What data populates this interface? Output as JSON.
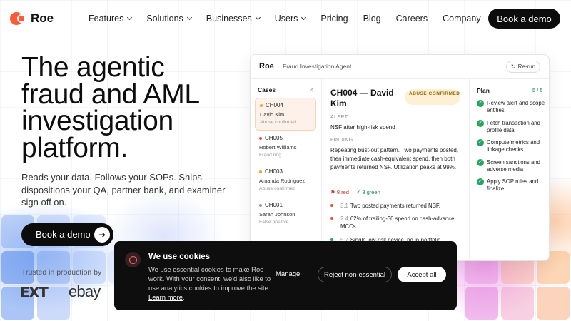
{
  "nav": {
    "brand": "Roe",
    "links": [
      {
        "label": "Features",
        "dropdown": true
      },
      {
        "label": "Solutions",
        "dropdown": true
      },
      {
        "label": "Businesses",
        "dropdown": true
      },
      {
        "label": "Users",
        "dropdown": true
      },
      {
        "label": "Pricing",
        "dropdown": false
      },
      {
        "label": "Blog",
        "dropdown": false
      },
      {
        "label": "Careers",
        "dropdown": false
      },
      {
        "label": "Company",
        "dropdown": false
      }
    ],
    "cta": "Book a demo"
  },
  "hero": {
    "title_lines": [
      "The agentic",
      "fraud and AML",
      "investigation",
      "platform."
    ],
    "subtitle": "Reads your data. Follows your SOPs. Ships dispositions your QA, partner bank, and examiner sign off on.",
    "cta": "Book a demo",
    "cta_icon": "arrow-right-icon",
    "trusted_label": "Trusted in production by",
    "customer_logos": [
      "EXT",
      "ebay"
    ]
  },
  "app": {
    "brand": "Roe",
    "agent_name": "Fraud Investigation Agent",
    "rerun_label": "Re-run",
    "cases": {
      "title": "Cases",
      "count": "4",
      "items": [
        {
          "id": "CH004",
          "name": "David Kim",
          "status": "Abuse confirmed",
          "dot_color": "#f0a030",
          "active": true
        },
        {
          "id": "CH005",
          "name": "Robert Williams",
          "status": "Fraud ring",
          "dot_color": "#e05a3a",
          "active": false
        },
        {
          "id": "CH003",
          "name": "Amanda Rodriguez",
          "status": "Abuse confirmed",
          "dot_color": "#f0a030",
          "active": false
        },
        {
          "id": "CH001",
          "name": "Sarah Johnson",
          "status": "False positive",
          "dot_color": "#999999",
          "active": false
        }
      ]
    },
    "detail": {
      "title": "CH004 — David Kim",
      "badge": "ABUSE CONFIRMED",
      "alert_label": "ALERT",
      "alert_text": "NSF after high-risk spend",
      "finding_label": "FINDING",
      "finding_text": "Repeating bust-out pattern. Two payments posted, then immediate cash-equivalent spend, then both payments returned NSF. Utilization peaks at 99%.",
      "red_count": "8 red",
      "green_count": "3 green",
      "bullets": [
        {
          "num": "3.1",
          "text": "Two posted payments returned NSF.",
          "color": "#e05a3a"
        },
        {
          "num": "2.4",
          "text": "62% of trailing-30 spend on cash-advance MCCs.",
          "color": "#e05a3a"
        },
        {
          "num": "5.7",
          "text": "Single low-risk device, no in-portfolio",
          "color": "#25a55f"
        }
      ]
    },
    "plan": {
      "title": "Plan",
      "count": "5 / 5",
      "steps": [
        "Review alert and scope entities",
        "Fetch transaction and profile data",
        "Compute metrics and linkage checks",
        "Screen sanctions and adverse media",
        "Apply SOP rules and finalize"
      ]
    }
  },
  "cookie": {
    "title": "We use cookies",
    "text": "We use essential cookies to make Roe work. With your consent, we'd also like to use analytics cookies to improve the site.",
    "learn_more": "Learn more",
    "manage": "Manage",
    "reject": "Reject non-essential",
    "accept": "Accept all"
  },
  "colors": {
    "brand": "#ff5a36",
    "dark": "#0c0c0c",
    "success": "#25a55f",
    "badge_bg": "#fdf0d4"
  }
}
